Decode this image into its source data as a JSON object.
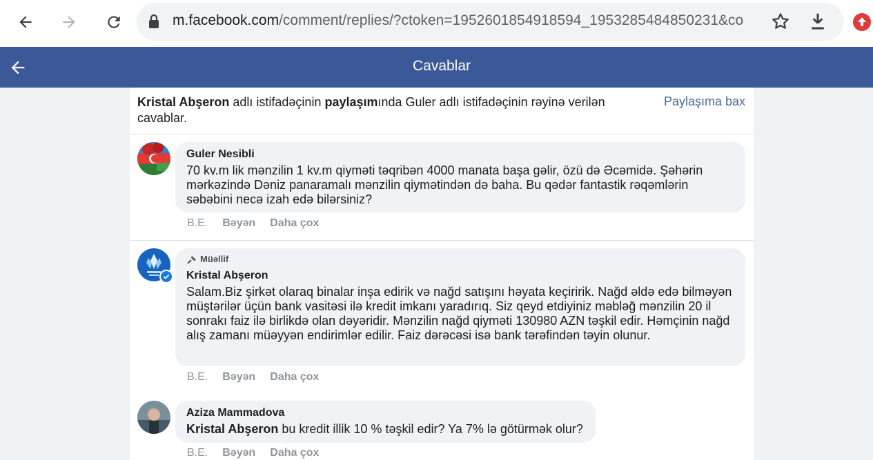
{
  "browser": {
    "url_host": "m.facebook.com",
    "url_path": "/comment/replies/?ctoken=1952601854918594_1953285484850231&co"
  },
  "header": {
    "title": "Cavablar"
  },
  "intro": {
    "author": "Kristal Abşeron",
    "part1": " adlı istifadəçinin ",
    "post_word": "paylaşım",
    "part2": "ında Guler adlı istifadəçinin rəyinə verilən cavablar.",
    "see_post": "Paylaşıma bax"
  },
  "comments": [
    {
      "name": "Guler Nesibli",
      "text": "70 kv.m lik mənzilin 1 kv.m qiyməti təqribən 4000 manata başa gəlir, özü də Əcəmidə. Şəhərin mərkəzində Dəniz panaramalı mənzilin qiymətindən də baha. Bu qədər fantastik rəqəmlərin səbəbini necə izah edə bilərsiniz?",
      "time": "B.E.",
      "reply": "Bəyən",
      "more": "Daha çox"
    },
    {
      "tag": "Müəllif",
      "name": "Kristal Abşeron",
      "text": "Salam.Biz şirkət olaraq binalar inşa edirik və nağd satışını həyata keçiririk. Nağd əldə edə bilməyən müştərilər üçün bank vasitəsi ilə kredit imkanı yaradırıq. Siz qeyd etdiyiniz məbləğ mənzilin 20 il sonrakı faiz ilə birlikdə olan dəyəridir. Mənzilin nağd qiyməti 130980 AZN təşkil edir. Həmçinin nağd alış zamanı müəyyən endirimlər edilir. Faiz dərəcəsi isə bank tərəfindən təyin olunur.",
      "time": "B.E.",
      "reply": "Bəyən",
      "more": "Daha çox"
    },
    {
      "name": "Aziza Mammadova",
      "mention": "Kristal Abşeron",
      "text": " bu kredit illik 10 % təşkil edir? Ya 7% lə götürmək olur?",
      "time": "B.E.",
      "reply": "Bəyən",
      "more": "Daha çox"
    }
  ],
  "colors": {
    "fb_blue": "#3b5998",
    "link": "#4b67a1",
    "bubble": "#f0f2f5"
  }
}
